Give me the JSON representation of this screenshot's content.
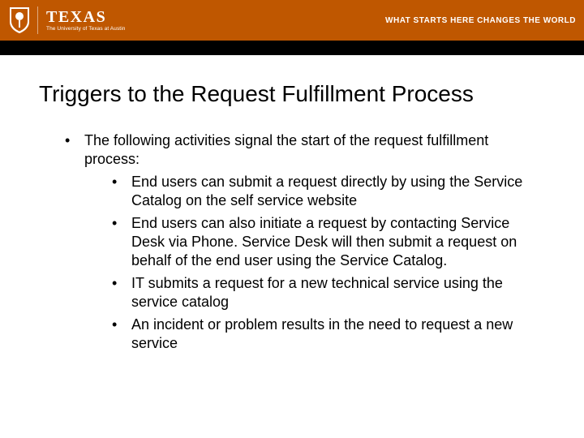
{
  "header": {
    "logo_word": "TEXAS",
    "logo_sub": "The University of Texas at Austin",
    "tagline": "WHAT STARTS HERE CHANGES THE WORLD"
  },
  "title": "Triggers to the Request Fulfillment Process",
  "intro": "The following activities signal the start of the request fulfillment process:",
  "bullets": [
    "End users can submit a request directly by using the Service Catalog on the self service website",
    "End users can also initiate a request by contacting Service Desk via Phone. Service Desk will then submit a request on behalf of the end user using the Service Catalog.",
    "IT submits a request for a new technical service using the service catalog",
    "An incident or problem results in the need to request a new service"
  ]
}
